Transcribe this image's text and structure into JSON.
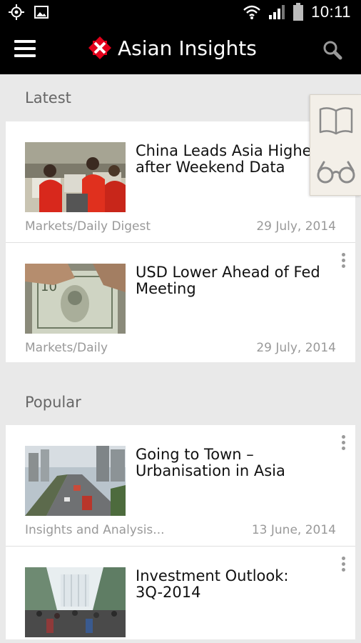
{
  "status_bar": {
    "time": "10:11",
    "icons": [
      "gps-icon",
      "image-icon",
      "wifi-icon",
      "signal-icon",
      "battery-icon"
    ]
  },
  "app_bar": {
    "title": "Asian Insights",
    "brand_color": "#e3001b",
    "icons": [
      "menu-icon",
      "logo-icon",
      "search-icon"
    ]
  },
  "side_panel": {
    "icons": [
      "book-icon",
      "glasses-icon"
    ]
  },
  "sections": [
    {
      "title": "Latest",
      "articles": [
        {
          "headline": "China Leads Asia Highe\nafter Weekend Data",
          "category": "Markets/Daily Digest",
          "date": "29 July, 2014",
          "thumb": "trading-floor"
        },
        {
          "headline": "USD Lower Ahead of Fed\nMeeting",
          "category": "Markets/Daily",
          "date": "29 July, 2014",
          "thumb": "dollar-bills"
        }
      ]
    },
    {
      "title": "Popular",
      "articles": [
        {
          "headline": "Going to Town –\nUrbanisation in Asia",
          "category": "Insights and Analysis...",
          "date": "13 June, 2014",
          "thumb": "city-road"
        },
        {
          "headline": "Investment Outlook:\n3Q-2014",
          "category": "",
          "date": "",
          "thumb": "city-plaza"
        }
      ]
    }
  ]
}
